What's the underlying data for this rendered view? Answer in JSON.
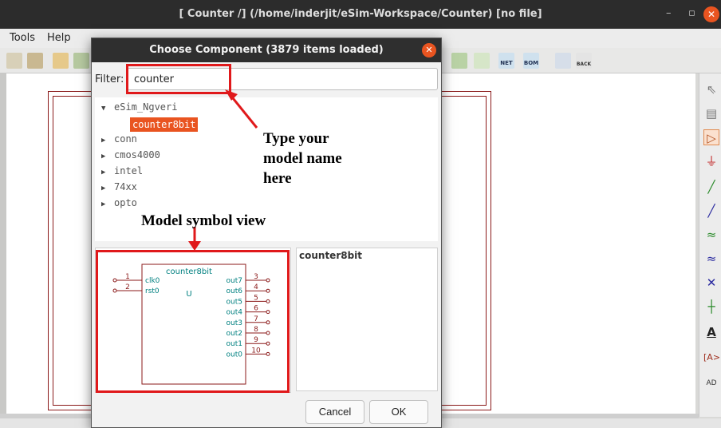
{
  "window": {
    "title": "[ Counter /] (/home/inderjit/eSim-Workspace/Counter) [no file]",
    "min_glyph": "–",
    "max_glyph": "▫",
    "close_glyph": "✕"
  },
  "menu": [
    "Tools",
    "Help"
  ],
  "toolbar": {
    "net_label": "NET",
    "bom_label": "BOM",
    "back_label": "BACK"
  },
  "dialog": {
    "title": "Choose Component (3879 items loaded)",
    "close_glyph": "✕",
    "filter_label": "Filter:",
    "filter_value": "counter",
    "tree": [
      {
        "label": "eSim_Ngveri",
        "expanded": true
      },
      {
        "label": "counter8bit",
        "selected": true
      },
      {
        "label": "conn",
        "expanded": false
      },
      {
        "label": "cmos4000",
        "expanded": false
      },
      {
        "label": "intel",
        "expanded": false
      },
      {
        "label": "74xx",
        "expanded": false
      },
      {
        "label": "opto",
        "expanded": false
      }
    ],
    "description_title": "counter8bit",
    "cancel_label": "Cancel",
    "ok_label": "OK"
  },
  "symbol": {
    "name": "counter8bit",
    "ref": "U",
    "left_pins": [
      {
        "num": "1",
        "name": "clk0"
      },
      {
        "num": "2",
        "name": "rst0"
      }
    ],
    "right_pins": [
      {
        "num": "3",
        "name": "out7"
      },
      {
        "num": "4",
        "name": "out6"
      },
      {
        "num": "5",
        "name": "out5"
      },
      {
        "num": "6",
        "name": "out4"
      },
      {
        "num": "7",
        "name": "out3"
      },
      {
        "num": "8",
        "name": "out2"
      },
      {
        "num": "9",
        "name": "out1"
      },
      {
        "num": "10",
        "name": "out0"
      }
    ]
  },
  "annotations": {
    "type_hint_line1": "Type your",
    "type_hint_line2": "model name",
    "type_hint_line3": "here",
    "symbol_hint": "Model symbol view"
  },
  "colors": {
    "accent": "#e95420",
    "annotation_red": "#e0191b",
    "schematic_red": "#8b1a1a",
    "symbol_teal": "#008080"
  }
}
